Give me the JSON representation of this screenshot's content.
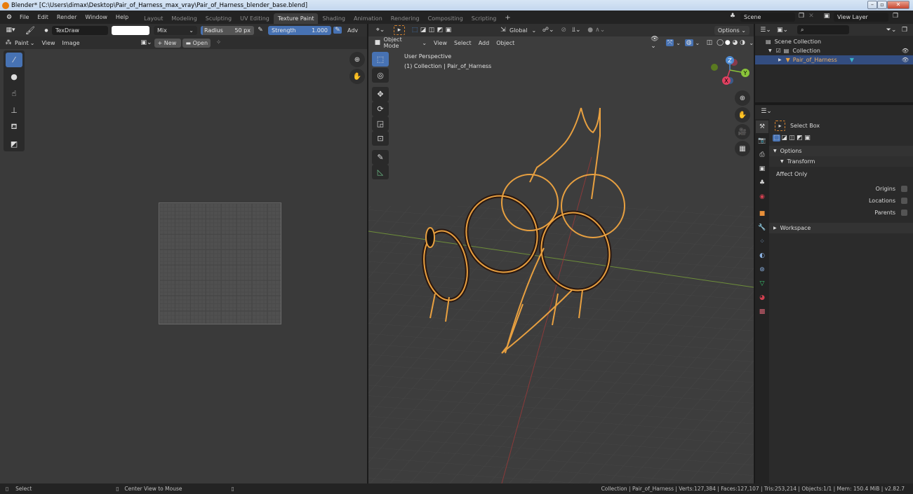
{
  "window": {
    "title": "Blender* [C:\\Users\\dimax\\Desktop\\Pair_of_Harness_max_vray\\Pair_of_Harness_blender_base.blend]",
    "controls": [
      "minimize",
      "maximize",
      "close"
    ]
  },
  "menu": [
    "File",
    "Edit",
    "Render",
    "Window",
    "Help"
  ],
  "workspaces": {
    "tabs": [
      "Layout",
      "Modeling",
      "Sculpting",
      "UV Editing",
      "Texture Paint",
      "Shading",
      "Animation",
      "Rendering",
      "Compositing",
      "Scripting"
    ],
    "active": "Texture Paint",
    "add": "+"
  },
  "scene": {
    "name": "Scene",
    "view_layer": "View Layer"
  },
  "image_editor": {
    "brush_name": "TexDraw",
    "blend_mode": "Mix",
    "radius_label": "Radius",
    "radius_value": "50 px",
    "strength_label": "Strength",
    "strength_value": "1.000",
    "advanced": "Adv",
    "mode": "Paint",
    "menus": [
      "View",
      "Image"
    ],
    "new_label": "New",
    "open_label": "Open",
    "tools": [
      "draw",
      "soften",
      "smear",
      "clone",
      "fill",
      "mask"
    ],
    "active_tool": "draw"
  },
  "viewport": {
    "mode": "Object Mode",
    "menus": [
      "View",
      "Select",
      "Add",
      "Object"
    ],
    "orientation": "Global",
    "options_label": "Options",
    "overlay_title": "User Perspective",
    "overlay_subtitle": "(1) Collection | Pair_of_Harness",
    "tools": [
      "select-box",
      "cursor",
      "move",
      "rotate",
      "scale",
      "transform",
      "annotate",
      "measure"
    ],
    "active_tool": "select-box",
    "gizmo_axes": [
      "X",
      "Y",
      "Z"
    ],
    "object_color": "#f0a030"
  },
  "outliner": {
    "search_placeholder": "",
    "root": "Scene Collection",
    "items": [
      {
        "label": "Collection",
        "level": 1,
        "selected": false
      },
      {
        "label": "Pair_of_Harness",
        "level": 2,
        "selected": true
      }
    ]
  },
  "properties": {
    "tool_name": "Select Box",
    "sections": {
      "options": "Options",
      "transform": "Transform",
      "affect_only": "Affect Only",
      "workspace": "Workspace"
    },
    "checkboxes": [
      {
        "label": "Origins",
        "checked": false
      },
      {
        "label": "Locations",
        "checked": false
      },
      {
        "label": "Parents",
        "checked": false
      }
    ]
  },
  "status": {
    "hint_left": "Select",
    "hint_middle": "Center View to Mouse",
    "stats": "Collection | Pair_of_Harness | Verts:127,384 | Faces:127,107 | Tris:253,214 | Objects:1/1 | Mem: 150.4 MiB | v2.82.7"
  }
}
